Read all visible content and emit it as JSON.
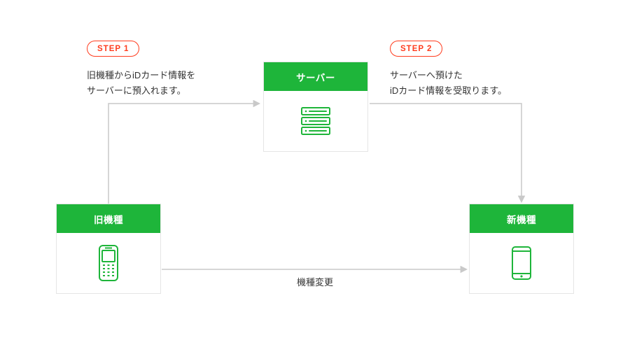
{
  "steps": [
    {
      "badge": "STEP 1",
      "desc": "旧機種からiDカード情報を\nサーバーに預入れます。"
    },
    {
      "badge": "STEP 2",
      "desc": "サーバーへ預けた\niDカード情報を受取ります。"
    }
  ],
  "nodes": {
    "old": {
      "title": "旧機種"
    },
    "server": {
      "title": "サーバー"
    },
    "new": {
      "title": "新機種"
    }
  },
  "bottom_label": "機種変更",
  "colors": {
    "green": "#1eb53a",
    "arrow": "#c9c9c9",
    "red": "#ff3c1e"
  }
}
